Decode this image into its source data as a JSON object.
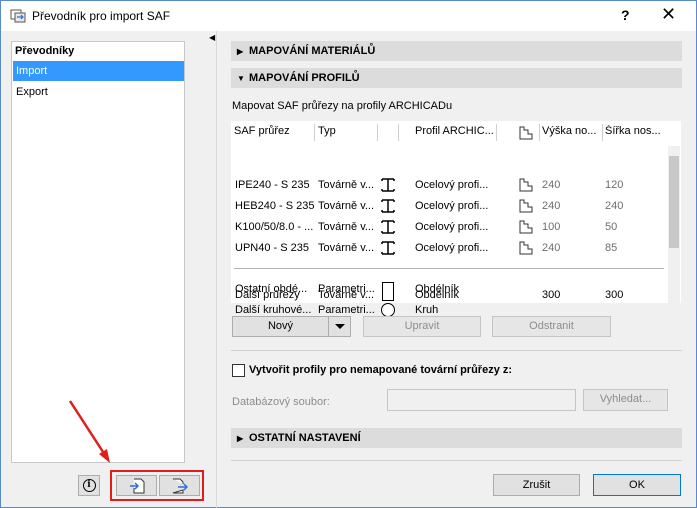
{
  "window": {
    "title": "Převodník pro import SAF",
    "help": "?",
    "close": "✕"
  },
  "sidebar": {
    "header": "Převodníky",
    "items": [
      {
        "label": "Import",
        "selected": true
      },
      {
        "label": "Export",
        "selected": false
      }
    ]
  },
  "sections": {
    "materials": "MAPOVÁNÍ MATERIÁLŮ",
    "profiles": "MAPOVÁNÍ PROFILŮ",
    "other": "OSTATNÍ NASTAVENÍ"
  },
  "profiles": {
    "description": "Mapovat SAF průřezy na profily ARCHICADu",
    "columns": [
      "SAF průřez",
      "Typ",
      "",
      "Profil ARCHIC...",
      "",
      "Výška no...",
      "Šířka nos..."
    ],
    "rows": [
      {
        "saf": "IPE240 - S 235",
        "type": "Továrně v...",
        "shape": "i-beam",
        "profile": "Ocelový profi...",
        "height": "240",
        "width": "120"
      },
      {
        "saf": "HEB240 - S 235",
        "type": "Továrně v...",
        "shape": "i-beam",
        "profile": "Ocelový profi...",
        "height": "240",
        "width": "240"
      },
      {
        "saf": "K100/50/8.0 - ...",
        "type": "Továrně v...",
        "shape": "i-beam",
        "profile": "Ocelový profi...",
        "height": "100",
        "width": "50"
      },
      {
        "saf": "UPN40 - S 235",
        "type": "Továrně v...",
        "shape": "i-beam",
        "profile": "Ocelový profi...",
        "height": "240",
        "width": "85"
      }
    ],
    "other_rows": [
      {
        "saf": "Ostatní obdé...",
        "type": "Parametri...",
        "shape": "square",
        "profile": "Obdélník",
        "height": "",
        "width": ""
      },
      {
        "saf": "Další kruhové...",
        "type": "Parametri...",
        "shape": "circle",
        "profile": "Kruh",
        "height": "",
        "width": ""
      },
      {
        "saf": "Další průřezy",
        "type": "Továrně v...",
        "shape": "square",
        "profile": "Obdélník",
        "height": "300",
        "width": "300"
      }
    ],
    "buttons": {
      "new": "Nový",
      "edit": "Upravit",
      "delete": "Odstranit"
    }
  },
  "unmapped": {
    "checkbox_label": "Vytvořit profily pro nemapované tovární průřezy z:",
    "checked": false,
    "db_label": "Databázový soubor:",
    "db_value": "",
    "browse": "Vyhledat..."
  },
  "footer": {
    "cancel": "Zrušit",
    "ok": "OK"
  },
  "colors": {
    "selection": "#3399ff",
    "highlight_box": "#e21b1b",
    "section_bar": "#dcdcdc"
  }
}
